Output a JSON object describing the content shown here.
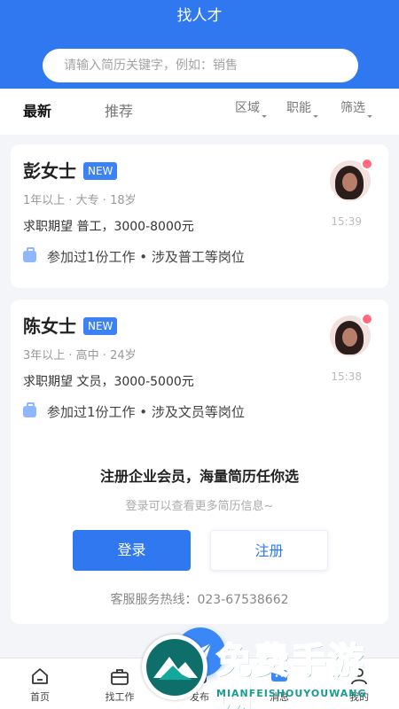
{
  "header": {
    "title": "找人才"
  },
  "search": {
    "placeholder": "请输入简历关键字，例如：销售"
  },
  "tabs": [
    {
      "label": "最新",
      "active": true
    },
    {
      "label": "推荐",
      "active": false
    }
  ],
  "filters": [
    "区域",
    "职能",
    "筛选"
  ],
  "candidates": [
    {
      "name": "彭女士",
      "badge": "NEW",
      "meta": "1年以上 · 大专 · 18岁",
      "expect": "求职期望 普工，3000-8000元",
      "history": "参加过1份工作 • 涉及普工等岗位",
      "time": "15:39"
    },
    {
      "name": "陈女士",
      "badge": "NEW",
      "meta": "3年以上 · 高中 · 24岁",
      "expect": "求职期望 文员，3000-5000元",
      "history": "参加过1份工作 • 涉及文员等岗位",
      "time": "15:38"
    }
  ],
  "login_panel": {
    "title": "注册企业会员，海量简历任你选",
    "subtitle": "登录可以查看更多简历信息~",
    "login_label": "登录",
    "register_label": "注册",
    "hotline": "客服服务热线：023-67538662"
  },
  "tabbar": [
    {
      "label": "首页",
      "icon": "home-icon"
    },
    {
      "label": "找工作",
      "icon": "briefcase-icon"
    },
    {
      "label": "发布",
      "icon": "publish-icon"
    },
    {
      "label": "消息",
      "icon": "message-icon"
    },
    {
      "label": "我的",
      "icon": "user-icon"
    }
  ],
  "watermark": {
    "title": "免费手游网",
    "subtitle": "MIANFEISHOUYOUWANG"
  },
  "colors": {
    "primary": "#2f78f0",
    "badge": "#3d82f5",
    "background": "#f3f5f8"
  }
}
